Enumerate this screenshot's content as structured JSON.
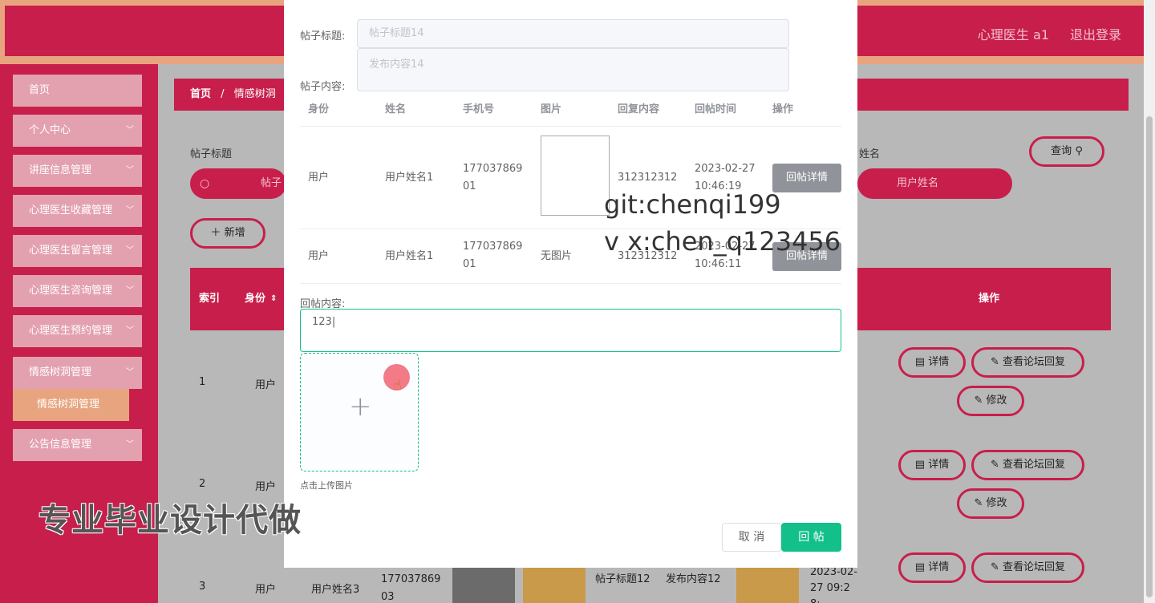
{
  "header": {
    "user": "心理医生 a1",
    "logout": "退出登录"
  },
  "sidebar": {
    "items": [
      {
        "label": "首页",
        "chevron": ""
      },
      {
        "label": "个人中心",
        "chevron": "﹀"
      },
      {
        "label": "讲座信息管理",
        "chevron": "﹀"
      },
      {
        "label": "心理医生收藏管理",
        "chevron": "﹀"
      },
      {
        "label": "心理医生留言管理",
        "chevron": "﹀"
      },
      {
        "label": "心理医生咨询管理",
        "chevron": "﹀"
      },
      {
        "label": "心理医生预约管理",
        "chevron": "﹀"
      },
      {
        "label": "情感树洞管理",
        "chevron": "﹀"
      },
      {
        "label": "公告信息管理",
        "chevron": "﹀"
      }
    ],
    "sub_item": "情感树洞管理"
  },
  "breadcrumb": {
    "home": "首页",
    "sep": "/",
    "current": "情感树洞"
  },
  "search": {
    "title_label": "帖子标题",
    "title_placeholder": "帖子",
    "name_label": "姓名",
    "name_placeholder": "用户姓名",
    "query_button": "查询",
    "add_button": "新增"
  },
  "table": {
    "headers": [
      "索引",
      "身份",
      "操作"
    ],
    "rows": [
      {
        "index": "1",
        "identity": "用户"
      },
      {
        "index": "2",
        "identity": "用户"
      },
      {
        "index": "3",
        "identity": "用户",
        "name": "用户姓名3",
        "phone": "17703786903",
        "title": "帖子标题12",
        "content": "发布内容12",
        "time": "2023-02-27 09:28:"
      }
    ],
    "btn_detail": "详情",
    "btn_view_reply": "查看论坛回复",
    "btn_edit": "修改"
  },
  "dialog": {
    "title_label": "帖子标题:",
    "title_value": "帖子标题14",
    "content_label": "帖子内容:",
    "content_value": "发布内容14",
    "columns": [
      "身份",
      "姓名",
      "手机号",
      "图片",
      "回复内容",
      "回帖时间",
      "操作"
    ],
    "replies": [
      {
        "identity": "用户",
        "name": "用户姓名1",
        "phone": "17703786901",
        "image": "",
        "content": "312312312",
        "time": "2023-02-27 10:46:19",
        "action": "回帖详情"
      },
      {
        "identity": "用户",
        "name": "用户姓名1",
        "phone": "17703786901",
        "image": "无图片",
        "content": "312312312",
        "time": "2023-02-27 10:46:11",
        "action": "回帖详情"
      }
    ],
    "reply_label": "回帖内容:",
    "reply_value": "123",
    "upload_hint": "点击上传图片",
    "cancel": "取 消",
    "submit": "回 帖"
  },
  "watermark": {
    "line1": "git:chenqi199",
    "line2": "v x:chen_q123456"
  },
  "promo": "专业毕业设计代做"
}
